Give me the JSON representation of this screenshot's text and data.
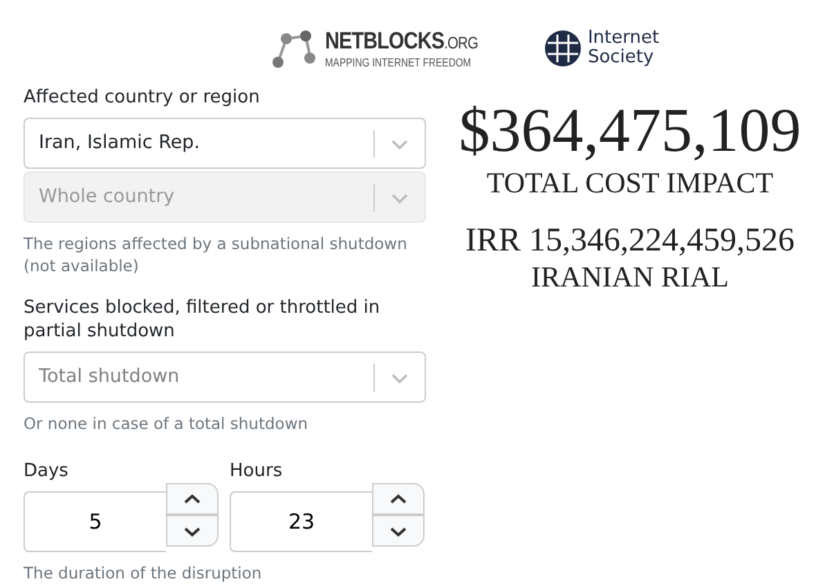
{
  "header": {
    "logos": [
      {
        "kind": "netblocks",
        "name": "NETBLOCKS",
        "suffix": ".ORG",
        "tagline": "MAPPING INTERNET FREEDOM"
      },
      {
        "kind": "isoc",
        "lines": [
          "Internet",
          "Society"
        ]
      }
    ]
  },
  "form": {
    "fields": [
      {
        "kind": "select",
        "label": "Affected country or region",
        "value": "Iran, Islamic Rep.",
        "disabled": false
      },
      {
        "kind": "select",
        "value": "Whole country",
        "disabled": true,
        "help": "The regions affected by a subnational shutdown (not available)"
      },
      {
        "kind": "select",
        "label": "Services blocked, filtered or throttled in partial shutdown",
        "placeholder": "Total shutdown",
        "disabled": false,
        "help": "Or none in case of a total shutdown"
      },
      {
        "kind": "duration",
        "spinners": [
          {
            "label": "Days",
            "value": "5"
          },
          {
            "label": "Hours",
            "value": "23"
          }
        ],
        "help": "The duration of the disruption"
      }
    ]
  },
  "result": {
    "amount": "$364,475,109",
    "amount_label": "TOTAL COST IMPACT",
    "local_amount": "IRR 15,346,224,459,526",
    "local_label": "IRANIAN RIAL"
  }
}
